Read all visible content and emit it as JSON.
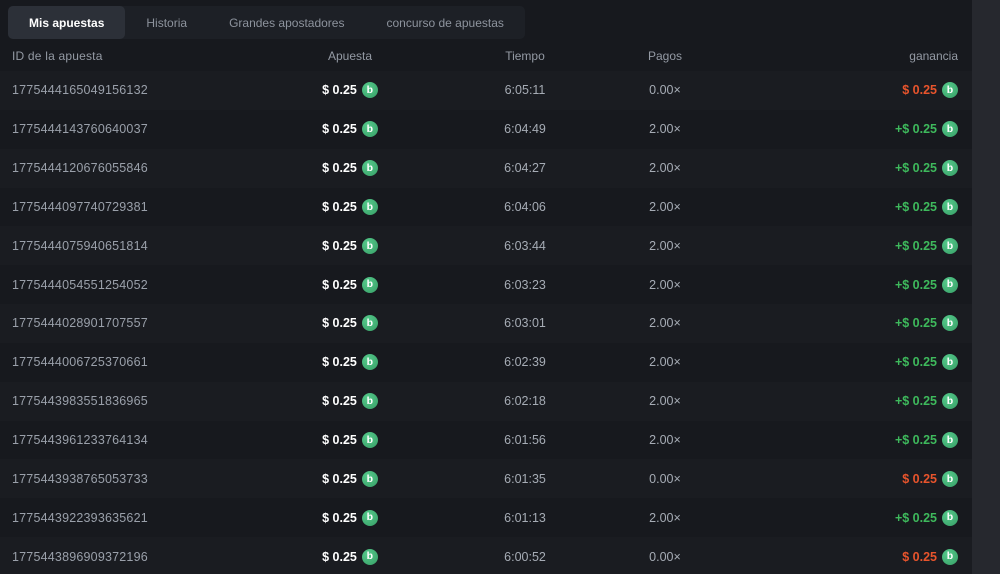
{
  "tabs": {
    "items": [
      {
        "label": "Mis apuestas",
        "active": true
      },
      {
        "label": "Historia",
        "active": false
      },
      {
        "label": "Grandes apostadores",
        "active": false
      },
      {
        "label": "concurso de apuestas",
        "active": false
      }
    ]
  },
  "table": {
    "headers": {
      "id": "ID de la apuesta",
      "bet": "Apuesta",
      "time": "Tiempo",
      "payout": "Pagos",
      "profit": "ganancia"
    },
    "coin_symbol": "b",
    "rows": [
      {
        "id": "1775444165049156132",
        "bet": "$ 0.25",
        "time": "6:05:11",
        "payout": "0.00×",
        "profit": "$ 0.25",
        "result": "loss"
      },
      {
        "id": "1775444143760640037",
        "bet": "$ 0.25",
        "time": "6:04:49",
        "payout": "2.00×",
        "profit": "+$ 0.25",
        "result": "win"
      },
      {
        "id": "1775444120676055846",
        "bet": "$ 0.25",
        "time": "6:04:27",
        "payout": "2.00×",
        "profit": "+$ 0.25",
        "result": "win"
      },
      {
        "id": "1775444097740729381",
        "bet": "$ 0.25",
        "time": "6:04:06",
        "payout": "2.00×",
        "profit": "+$ 0.25",
        "result": "win"
      },
      {
        "id": "1775444075940651814",
        "bet": "$ 0.25",
        "time": "6:03:44",
        "payout": "2.00×",
        "profit": "+$ 0.25",
        "result": "win"
      },
      {
        "id": "1775444054551254052",
        "bet": "$ 0.25",
        "time": "6:03:23",
        "payout": "2.00×",
        "profit": "+$ 0.25",
        "result": "win"
      },
      {
        "id": "1775444028901707557",
        "bet": "$ 0.25",
        "time": "6:03:01",
        "payout": "2.00×",
        "profit": "+$ 0.25",
        "result": "win"
      },
      {
        "id": "1775444006725370661",
        "bet": "$ 0.25",
        "time": "6:02:39",
        "payout": "2.00×",
        "profit": "+$ 0.25",
        "result": "win"
      },
      {
        "id": "1775443983551836965",
        "bet": "$ 0.25",
        "time": "6:02:18",
        "payout": "2.00×",
        "profit": "+$ 0.25",
        "result": "win"
      },
      {
        "id": "1775443961233764134",
        "bet": "$ 0.25",
        "time": "6:01:56",
        "payout": "2.00×",
        "profit": "+$ 0.25",
        "result": "win"
      },
      {
        "id": "1775443938765053733",
        "bet": "$ 0.25",
        "time": "6:01:35",
        "payout": "0.00×",
        "profit": "$ 0.25",
        "result": "loss"
      },
      {
        "id": "1775443922393635621",
        "bet": "$ 0.25",
        "time": "6:01:13",
        "payout": "2.00×",
        "profit": "+$ 0.25",
        "result": "win"
      },
      {
        "id": "1775443896909372196",
        "bet": "$ 0.25",
        "time": "6:00:52",
        "payout": "0.00×",
        "profit": "$ 0.25",
        "result": "loss"
      }
    ]
  },
  "colors": {
    "win": "#3eb95c",
    "loss": "#e8542c",
    "coin": "#3fa96d",
    "background": "#17191e",
    "active_tab": "#2c3038"
  }
}
